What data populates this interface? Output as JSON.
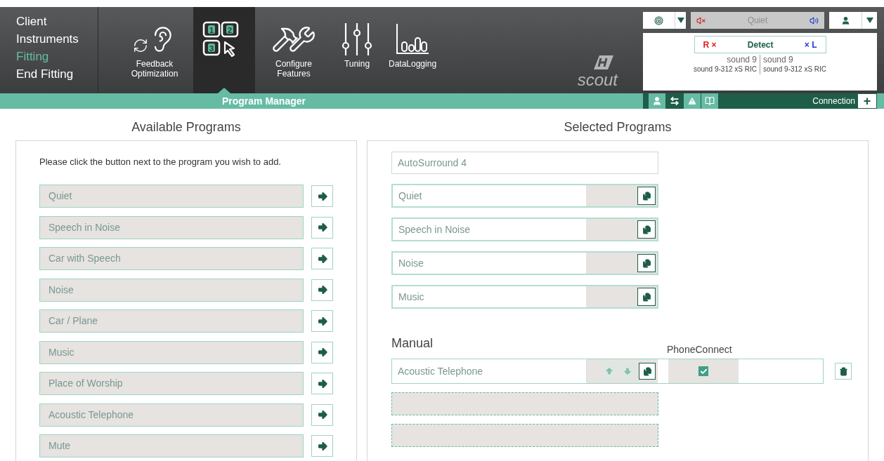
{
  "nav": [
    {
      "label": "Client",
      "selected": false
    },
    {
      "label": "Instruments",
      "selected": false
    },
    {
      "label": "Fitting",
      "selected": true
    },
    {
      "label": "End Fitting",
      "selected": false
    }
  ],
  "tabs": [
    {
      "kind": "feedback",
      "label": "Feedback Optimization",
      "selected": false
    },
    {
      "kind": "program",
      "selected": true,
      "icon_digits": [
        "1",
        "2",
        "3"
      ]
    },
    {
      "kind": "configure",
      "label": "Configure Features",
      "selected": false
    },
    {
      "kind": "tuning",
      "label": "Tuning",
      "selected": false
    },
    {
      "kind": "datalogging",
      "label": "DataLogging",
      "selected": false
    }
  ],
  "section_title": "Program Manager",
  "logo": "scout",
  "device_panel": {
    "program": "Quiet",
    "detect": {
      "right": "R",
      "right_mark": "×",
      "label": "Detect",
      "left_mark": "×",
      "left": "L"
    },
    "sides": [
      {
        "name": "sound 9",
        "model": "sound 9-312 xS RIC"
      },
      {
        "name": "sound 9",
        "model": "sound 9-312 xS RIC"
      }
    ],
    "status_tabs": [
      {
        "kind": "person",
        "selected": false
      },
      {
        "kind": "swap",
        "selected": true
      },
      {
        "kind": "warning",
        "selected": false
      },
      {
        "kind": "book",
        "selected": false
      }
    ],
    "connection": "Connection",
    "connection_button": "+"
  },
  "available": {
    "title": "Available Programs",
    "instruction": "Please click the button next to the program you wish to add.",
    "programs": [
      "Quiet",
      "Speech in Noise",
      "Car with Speech",
      "Noise",
      "Car / Plane",
      "Music",
      "Place of Worship",
      "Acoustic Telephone",
      "Mute"
    ]
  },
  "selected": {
    "title": "Selected Programs",
    "base": "AutoSurround 4",
    "programs": [
      "Quiet",
      "Speech in Noise",
      "Noise",
      "Music"
    ],
    "manual": {
      "title": "Manual",
      "column": "PhoneConnect",
      "programs": [
        {
          "name": "Acoustic Telephone",
          "phone_connect": true
        }
      ],
      "empty_slots": [
        {
          "kind": "empty"
        },
        {
          "kind": "empty"
        }
      ]
    }
  }
}
